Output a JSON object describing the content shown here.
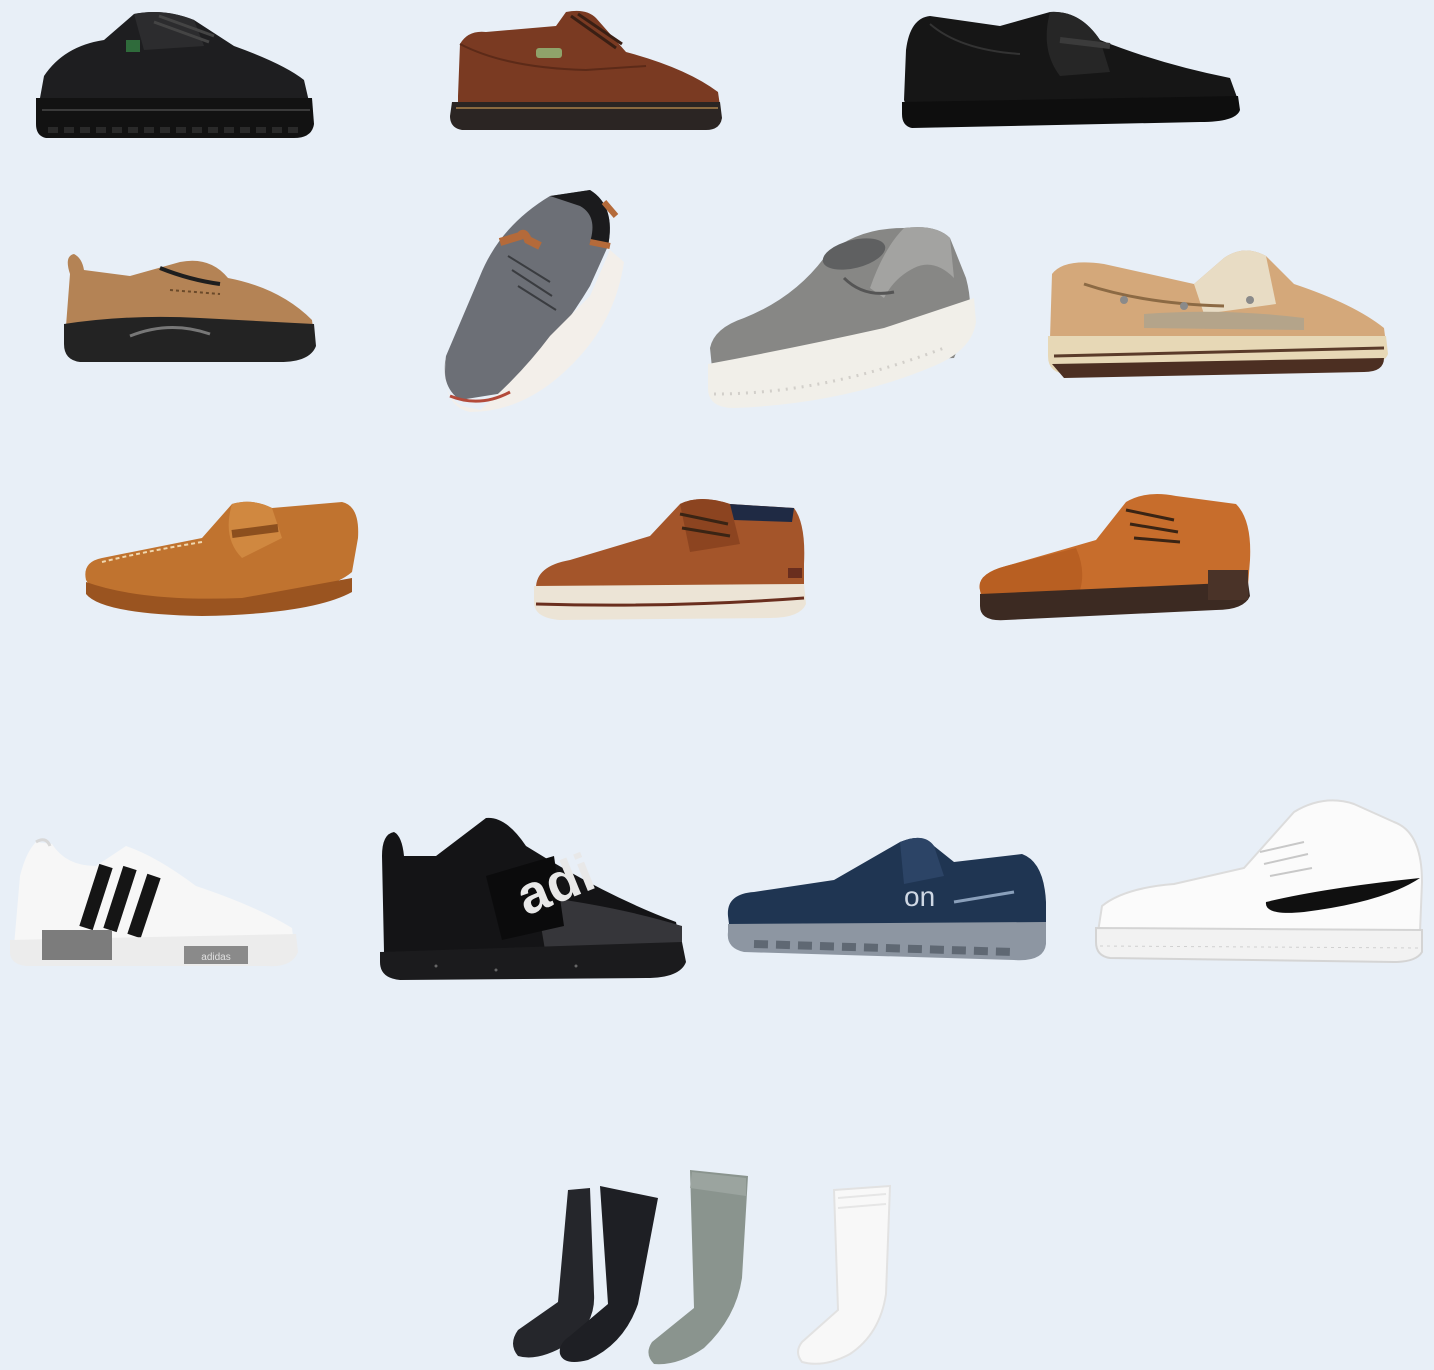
{
  "background": "#e8eff7",
  "items": [
    {
      "name": "black-leather-oxford-icon",
      "colors": [
        "#1c1c1e",
        "#2a2a2c"
      ],
      "brand_text": ""
    },
    {
      "name": "brown-leather-oxford-icon",
      "colors": [
        "#7a3a22",
        "#2e2624"
      ],
      "brand_text": ""
    },
    {
      "name": "black-penny-loafer-icon",
      "colors": [
        "#141414",
        "#2b2b2b"
      ],
      "brand_text": ""
    },
    {
      "name": "tan-suede-slip-on-icon",
      "colors": [
        "#b08153",
        "#2a2a2a"
      ],
      "brand_text": ""
    },
    {
      "name": "gray-knit-sneaker-icon",
      "colors": [
        "#6b6e75",
        "#f2eeea"
      ],
      "brand_text": ""
    },
    {
      "name": "gray-canvas-slip-on-icon",
      "colors": [
        "#858583",
        "#f1efe9"
      ],
      "brand_text": ""
    },
    {
      "name": "tan-boat-shoe-icon",
      "colors": [
        "#d2a77a",
        "#e6d7b6"
      ],
      "brand_text": ""
    },
    {
      "name": "cognac-driving-loafer-icon",
      "colors": [
        "#c0732f",
        "#9a5420"
      ],
      "brand_text": ""
    },
    {
      "name": "brown-casual-oxford-icon",
      "colors": [
        "#a4552a",
        "#ece4d6"
      ],
      "brand_text": ""
    },
    {
      "name": "cognac-cap-toe-oxford-icon",
      "colors": [
        "#c76d2c",
        "#3c2a22"
      ],
      "brand_text": ""
    },
    {
      "name": "white-striped-sneaker-icon",
      "colors": [
        "#f7f7f7",
        "#151515"
      ],
      "brand_text": "adidas"
    },
    {
      "name": "black-slip-on-sneaker-icon",
      "colors": [
        "#141416",
        "#36363a"
      ],
      "brand_text": "adi"
    },
    {
      "name": "navy-running-shoe-icon",
      "colors": [
        "#1f3552",
        "#8d96a2"
      ],
      "brand_text": "on"
    },
    {
      "name": "white-high-top-sneaker-icon",
      "colors": [
        "#fbfbfb",
        "#101010"
      ],
      "brand_text": ""
    },
    {
      "name": "black-sock-icon",
      "colors": [
        "#1e1f24"
      ],
      "brand_text": ""
    },
    {
      "name": "gray-sock-icon",
      "colors": [
        "#8a948e"
      ],
      "brand_text": ""
    },
    {
      "name": "white-sock-icon",
      "colors": [
        "#f8f8f8"
      ],
      "brand_text": ""
    }
  ]
}
